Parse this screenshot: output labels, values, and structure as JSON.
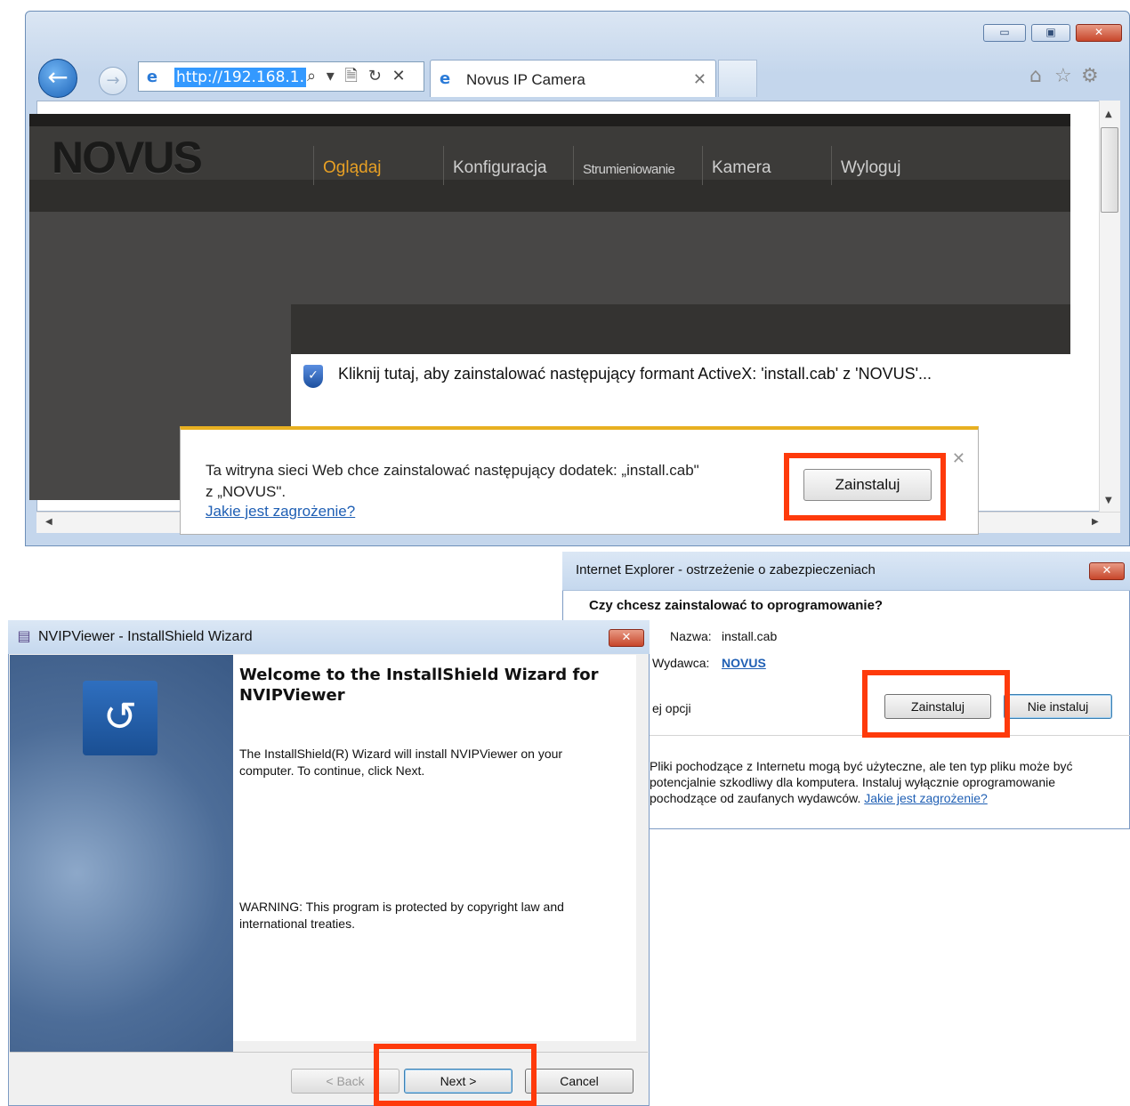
{
  "browser": {
    "address_url": "http://192.168.1.",
    "address_tools": "⌕ ▾ 🗎 ↻ ✕",
    "tab_title": "Novus IP Camera",
    "tab_close": "✕",
    "window_buttons": {
      "minimize": "▭",
      "maximize": "▣",
      "close": "✕"
    },
    "toolbar_icons": [
      "home-icon",
      "star-icon",
      "gear-icon"
    ]
  },
  "site": {
    "logo": "NOVUS",
    "nav": [
      "Oglądaj",
      "Konfiguracja",
      "Strumieniowanie",
      "Kamera",
      "Wyloguj"
    ],
    "activex_message": "Kliknij tutaj, aby zainstalować następujący formant ActiveX: 'install.cab' z 'NOVUS'..."
  },
  "notification": {
    "line1": "Ta witryna sieci Web chce zainstalować następujący dodatek: „install.cab\"",
    "line2": "z „NOVUS\".",
    "link": "Jakie jest zagrożenie?",
    "install_button": "Zainstaluj",
    "close": "✕"
  },
  "security_dialog": {
    "title": "Internet Explorer - ostrzeżenie o zabezpieczeniach",
    "question": "Czy chcesz zainstalować to oprogramowanie?",
    "name_label": "Nazwa:",
    "name_value": "install.cab",
    "publisher_label": "Wydawca:",
    "publisher_value": "NOVUS",
    "options_text": "ej opcji",
    "install_button": "Zainstaluj",
    "noinstall_button": "Nie instaluj",
    "warning_text": "Pliki pochodzące z Internetu mogą być użyteczne, ale ten typ pliku może być potencjalnie szkodliwy dla komputera. Instaluj wyłącznie oprogramowanie pochodzące od zaufanych wydawców.",
    "warning_link": "Jakie jest zagrożenie?",
    "close": "✕"
  },
  "wizard": {
    "title": "NVIPViewer - InstallShield Wizard",
    "heading": "Welcome to the InstallShield Wizard for NVIPViewer",
    "body": "The InstallShield(R) Wizard will install NVIPViewer on your computer. To continue, click Next.",
    "warning": "WARNING: This program is protected by copyright law and international treaties.",
    "back_button": "< Back",
    "next_button": "Next >",
    "cancel_button": "Cancel",
    "close": "✕"
  },
  "colors": {
    "highlight": "#fe3a0b",
    "accent_nav": "#e8a024",
    "link": "#1f5fb4"
  }
}
